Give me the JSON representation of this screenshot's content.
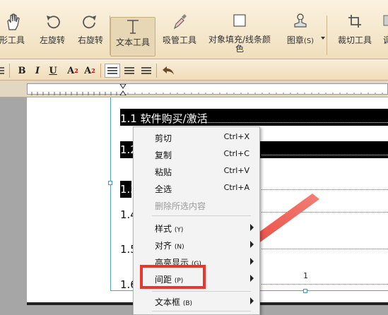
{
  "toolbar": {
    "items": [
      {
        "label": "矩形工具"
      },
      {
        "label": "左旋转"
      },
      {
        "label": "右旋转"
      },
      {
        "label": "文本工具"
      },
      {
        "label": "吸管工具"
      },
      {
        "label": "对象填充/线条颜\n色"
      },
      {
        "label": "图章"
      },
      {
        "label": "(S)"
      },
      {
        "label": "裁切工具"
      },
      {
        "label": "调"
      }
    ]
  },
  "format": {
    "bold": "B",
    "italic": "I",
    "underline": "U",
    "superscript": "A",
    "subscript": "A"
  },
  "document": {
    "toc": [
      {
        "text": "1.1 软件购买/激活"
      },
      {
        "text": "1.2"
      },
      {
        "text": "1.3"
      },
      {
        "text": "1.4"
      },
      {
        "text": "1.5"
      },
      {
        "text": "1.6"
      }
    ],
    "page_number": "1"
  },
  "context_menu": {
    "items": [
      {
        "label": "剪切",
        "shortcut": "Ctrl+X"
      },
      {
        "label": "复制",
        "shortcut": "Ctrl+C"
      },
      {
        "label": "粘贴",
        "shortcut": "Ctrl+V"
      },
      {
        "label": "全选",
        "shortcut": "Ctrl+A"
      },
      {
        "label": "删除所选内容",
        "disabled": true
      },
      {
        "label": "样式",
        "key": "(Y)"
      },
      {
        "label": "对齐",
        "key": "(N)"
      },
      {
        "label": "高亮显示",
        "key": "(G)"
      },
      {
        "label": "间距",
        "key": "(P)",
        "highlighted": true
      },
      {
        "label": "文本框",
        "key": "(B)"
      }
    ]
  },
  "colors": {
    "highlight_box": "#e8372c",
    "arrow": "#e8372c",
    "toolbar_bg": "#f5e7ca"
  }
}
